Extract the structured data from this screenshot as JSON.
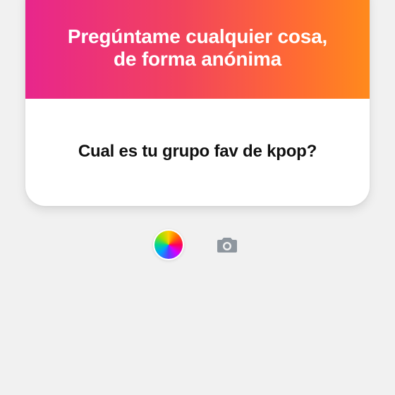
{
  "card": {
    "title_line1": "Pregúntame cualquier cosa,",
    "title_line2": "de forma anónima",
    "answer": "Cual es tu grupo fav de kpop?"
  },
  "controls": {
    "color_icon": "color-wheel-icon",
    "camera_icon": "camera-icon"
  },
  "colors": {
    "gradient_start": "#e8268c",
    "gradient_end": "#ff8a1c",
    "background": "#f1f1f1",
    "camera_icon": "#8e969e"
  }
}
